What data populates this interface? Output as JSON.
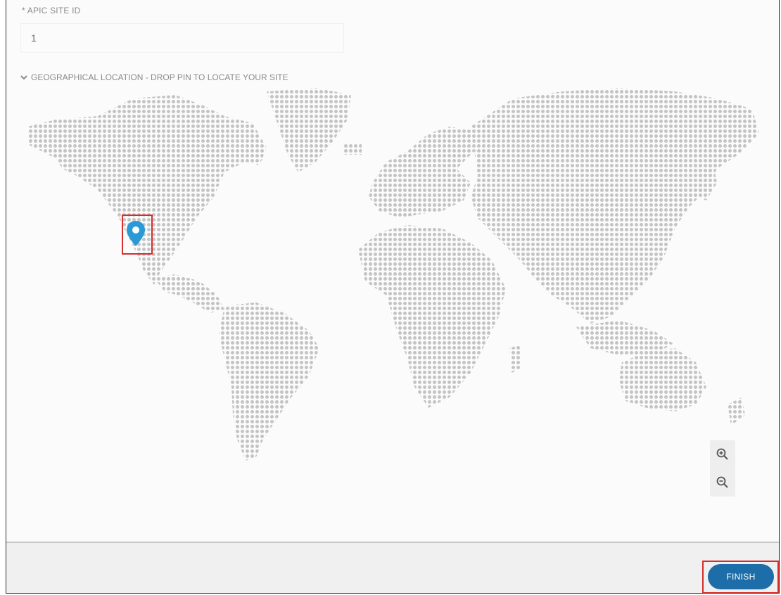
{
  "form": {
    "site_id_label": "* APIC SITE ID",
    "site_id_value": "1"
  },
  "location_section": {
    "header_label": "GEOGRAPHICAL LOCATION - DROP PIN TO LOCATE YOUR SITE",
    "collapse_icon": "chevron-down-icon"
  },
  "map": {
    "dot_color": "#c4c4c4",
    "pin_color": "#2a9ad6",
    "pin_icon": "map-pin-icon",
    "zoom_in_icon": "zoom-in-icon",
    "zoom_out_icon": "zoom-out-icon"
  },
  "footer": {
    "finish_label": "FINISH",
    "button_color": "#1d6ea8",
    "highlight_color": "#d62d2d"
  }
}
